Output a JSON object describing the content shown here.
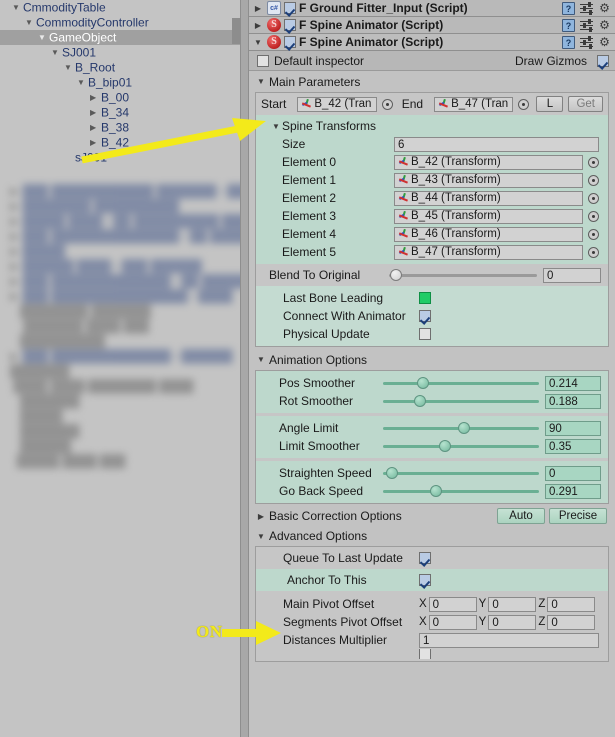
{
  "hierarchy": {
    "name": "scene-hierarchy",
    "items": [
      {
        "label": "CmmodityTable",
        "indent": 0,
        "fold": "open",
        "selected": false
      },
      {
        "label": "CommodityController",
        "indent": 1,
        "fold": "open",
        "selected": false
      },
      {
        "label": "GameObject",
        "indent": 2,
        "fold": "open",
        "selected": true
      },
      {
        "label": "SJ001",
        "indent": 3,
        "fold": "open",
        "selected": false
      },
      {
        "label": "B_Root",
        "indent": 4,
        "fold": "open",
        "selected": false
      },
      {
        "label": "B_bip01",
        "indent": 5,
        "fold": "open",
        "selected": false
      },
      {
        "label": "B_00",
        "indent": 6,
        "fold": "closed",
        "selected": false
      },
      {
        "label": "B_34",
        "indent": 6,
        "fold": "closed",
        "selected": false
      },
      {
        "label": "B_38",
        "indent": 6,
        "fold": "closed",
        "selected": false
      },
      {
        "label": "B_42",
        "indent": 6,
        "fold": "closed",
        "selected": false
      },
      {
        "label": "sJ001",
        "indent": 4,
        "fold": "none",
        "selected": false
      }
    ]
  },
  "components": [
    {
      "title": "F Ground Fitter_Input (Script)",
      "fold": "closed",
      "icon": "cs-script-icon",
      "enabled": true
    },
    {
      "title": "F Spine Animator (Script)",
      "fold": "closed",
      "icon": "spine-script-icon",
      "enabled": true
    },
    {
      "title": "F Spine Animator (Script)",
      "fold": "open",
      "icon": "spine-script-icon",
      "enabled": true
    }
  ],
  "inspector_options": {
    "default_inspector_label": "Default inspector",
    "default_inspector_checked": false,
    "draw_gizmos_label": "Draw Gizmos",
    "draw_gizmos_checked": true
  },
  "main_parameters": {
    "title": "Main Parameters",
    "fold": "open",
    "start_label": "Start",
    "start_value": "B_42 (Tran",
    "end_label": "End",
    "end_value": "B_47 (Tran",
    "l_button": "L",
    "get_button": "Get",
    "spine_transforms": {
      "title": "Spine Transforms",
      "fold": "open",
      "size_label": "Size",
      "size_value": "6",
      "elements": [
        {
          "label": "Element 0",
          "value": "B_42 (Transform)"
        },
        {
          "label": "Element 1",
          "value": "B_43 (Transform)"
        },
        {
          "label": "Element 2",
          "value": "B_44 (Transform)"
        },
        {
          "label": "Element 3",
          "value": "B_45 (Transform)"
        },
        {
          "label": "Element 4",
          "value": "B_46 (Transform)"
        },
        {
          "label": "Element 5",
          "value": "B_47 (Transform)"
        }
      ]
    },
    "blend_to_original": {
      "label": "Blend To Original",
      "value": "0",
      "slider_pct": 3
    },
    "toggles": [
      {
        "label": "Last Bone Leading",
        "state": "green"
      },
      {
        "label": "Connect With Animator",
        "state": "checked"
      },
      {
        "label": "Physical Update",
        "state": "off"
      }
    ]
  },
  "animation_options": {
    "title": "Animation Options",
    "fold": "open",
    "group1": [
      {
        "label": "Pos Smoother",
        "value": "0.214",
        "slider_pct": 22
      },
      {
        "label": "Rot Smoother",
        "value": "0.188",
        "slider_pct": 20
      }
    ],
    "group2": [
      {
        "label": "Angle Limit",
        "value": "90",
        "slider_pct": 48
      },
      {
        "label": "Limit Smoother",
        "value": "0.35",
        "slider_pct": 36
      }
    ],
    "group3": [
      {
        "label": "Straighten Speed",
        "value": "0",
        "slider_pct": 2
      },
      {
        "label": "Go Back Speed",
        "value": "0.291",
        "slider_pct": 30
      }
    ]
  },
  "basic_correction_options": {
    "title": "Basic Correction Options",
    "fold": "closed",
    "auto_button": "Auto",
    "precise_button": "Precise"
  },
  "advanced_options": {
    "title": "Advanced Options",
    "fold": "open",
    "queue_to_last_update": {
      "label": "Queue To Last Update",
      "checked": true
    },
    "anchor_to_this": {
      "label": "Anchor To This",
      "checked": true
    },
    "main_pivot_offset": {
      "label": "Main Pivot Offset",
      "x": "0",
      "y": "0",
      "z": "0"
    },
    "segments_pivot_offset": {
      "label": "Segments Pivot Offset",
      "x": "0",
      "y": "0",
      "z": "0"
    },
    "distances_multiplier": {
      "label": "Distances Multiplier",
      "value": "1"
    },
    "axis_labels": {
      "x": "X",
      "y": "Y",
      "z": "Z"
    }
  },
  "annotations": {
    "on_label": "ON"
  },
  "colors": {
    "accent_green": "#1fcc66",
    "annotation_yellow": "#f3ea1a",
    "panel_green": "#bdd8cc",
    "slider_green": "#6aaf93",
    "hierarchy_link": "#25386b",
    "selection_gray": "#a0a0a0"
  }
}
